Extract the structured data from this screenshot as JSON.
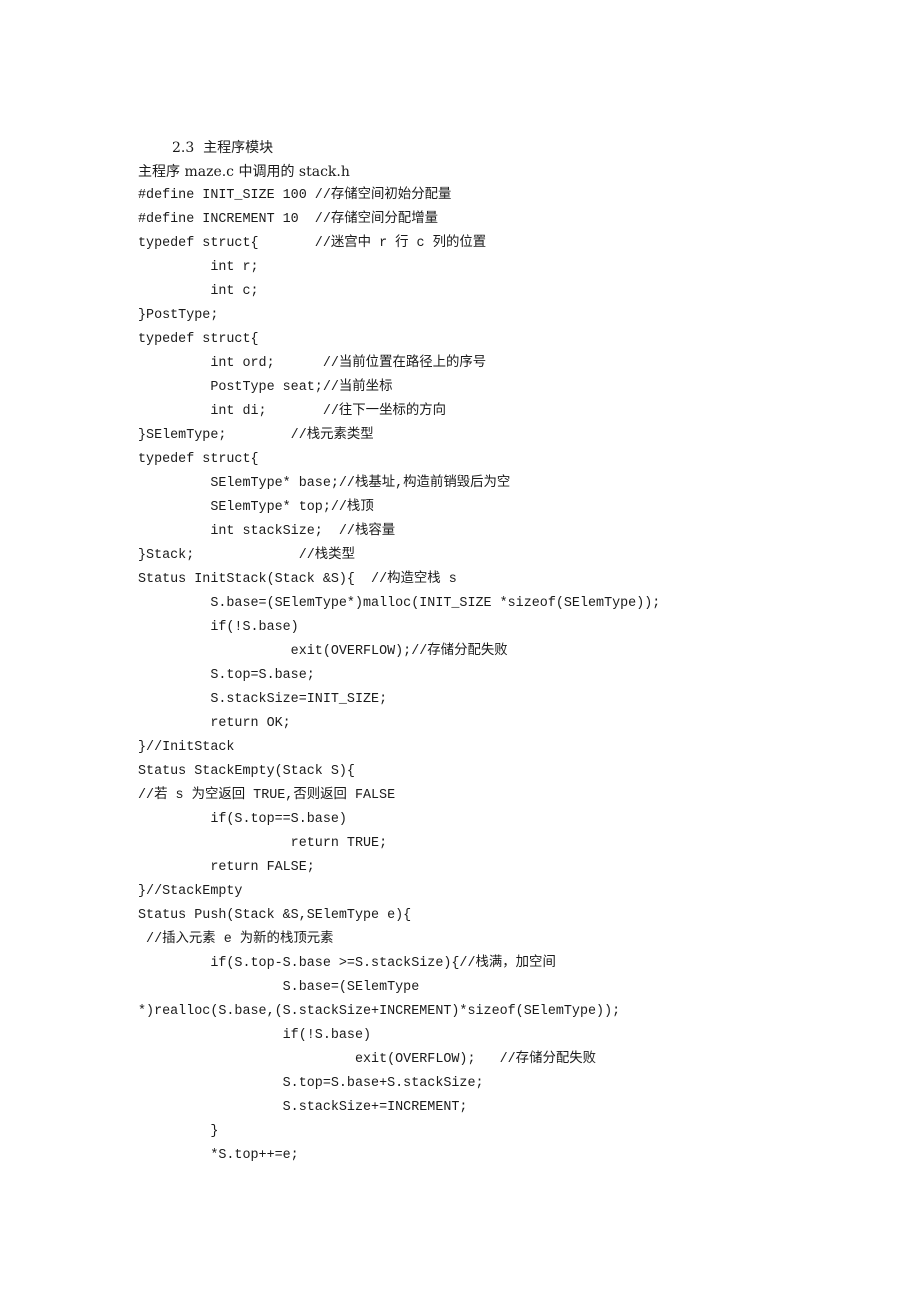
{
  "document": {
    "section_heading": "2.3  主程序模块",
    "intro": "主程序 maze.c 中调用的 stack.h",
    "code_lines": [
      "#define INIT_SIZE 100 //存储空间初始分配量",
      "#define INCREMENT 10  //存储空间分配增量",
      "typedef struct{       //迷宫中 r 行 c 列的位置",
      "         int r;",
      "         int c;",
      "}PostType;",
      "typedef struct{",
      "         int ord;      //当前位置在路径上的序号",
      "         PostType seat;//当前坐标",
      "         int di;       //往下一坐标的方向",
      "}SElemType;        //栈元素类型",
      "typedef struct{",
      "         SElemType* base;//栈基址,构造前销毁后为空",
      "         SElemType* top;//栈顶",
      "         int stackSize;  //栈容量",
      "}Stack;             //栈类型",
      "Status InitStack(Stack &S){  //构造空栈 s",
      "         S.base=(SElemType*)malloc(INIT_SIZE *sizeof(SElemType));",
      "         if(!S.base)",
      "                   exit(OVERFLOW);//存储分配失败",
      "         S.top=S.base;",
      "         S.stackSize=INIT_SIZE;",
      "         return OK;",
      "}//InitStack",
      "Status StackEmpty(Stack S){",
      "//若 s 为空返回 TRUE,否则返回 FALSE",
      "         if(S.top==S.base)",
      "                   return TRUE;",
      "         return FALSE;",
      "}//StackEmpty",
      "Status Push(Stack &S,SElemType e){",
      " //插入元素 e 为新的栈顶元素",
      "         if(S.top-S.base >=S.stackSize){//栈满，加空间",
      "                  S.base=(SElemType",
      "*)realloc(S.base,(S.stackSize+INCREMENT)*sizeof(SElemType));",
      "                  if(!S.base)",
      "                           exit(OVERFLOW);   //存储分配失败",
      "                  S.top=S.base+S.stackSize;",
      "                  S.stackSize+=INCREMENT;",
      "         }",
      "         *S.top++=e;"
    ]
  }
}
